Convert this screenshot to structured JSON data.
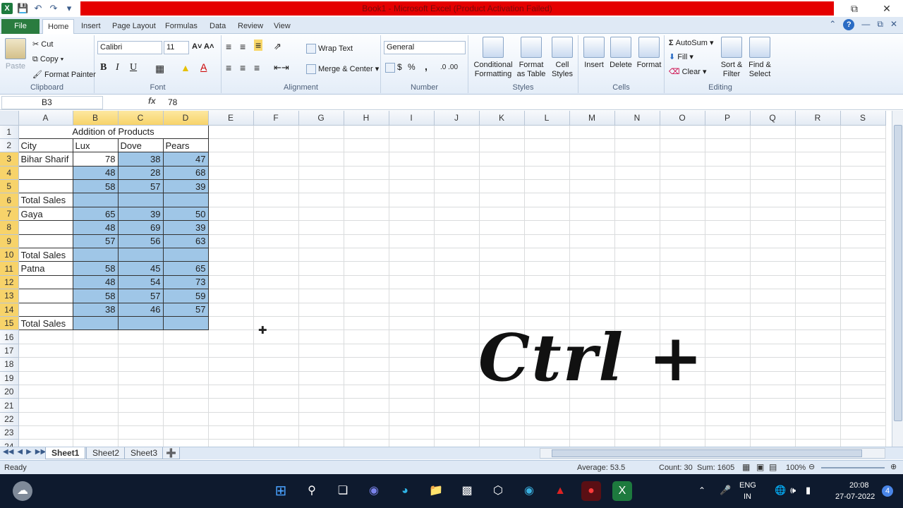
{
  "window": {
    "title": "Book1 - Microsoft Excel (Product Activation Failed)"
  },
  "tabs": [
    "File",
    "Home",
    "Insert",
    "Page Layout",
    "Formulas",
    "Data",
    "Review",
    "View"
  ],
  "ribbon": {
    "clipboard": {
      "paste": "Paste",
      "cut": "Cut",
      "copy": "Copy",
      "format_painter": "Format Painter",
      "label": "Clipboard"
    },
    "font": {
      "name": "Calibri",
      "size": "11",
      "bold": "B",
      "italic": "I",
      "underline": "U",
      "label": "Font"
    },
    "alignment": {
      "wrap_text": "Wrap Text",
      "merge_center": "Merge & Center",
      "label": "Alignment"
    },
    "number": {
      "format": "General",
      "currency": "$",
      "percent": "%",
      "comma": ",",
      "label": "Number"
    },
    "styles": {
      "conditional": "Conditional Formatting",
      "format_table": "Format as Table",
      "cell_styles": "Cell Styles",
      "label": "Styles"
    },
    "cells": {
      "insert": "Insert",
      "delete": "Delete",
      "format": "Format",
      "label": "Cells"
    },
    "editing": {
      "autosum": "AutoSum",
      "fill": "Fill",
      "clear": "Clear",
      "sort_filter": "Sort & Filter",
      "find_select": "Find & Select",
      "label": "Editing"
    }
  },
  "formula_bar": {
    "name_box": "B3",
    "fx": "fx",
    "value": "78"
  },
  "columns": [
    "A",
    "B",
    "C",
    "D",
    "E",
    "F",
    "G",
    "H",
    "I",
    "J",
    "K",
    "L",
    "M",
    "N",
    "O",
    "P",
    "Q",
    "R",
    "S"
  ],
  "sheet": {
    "title": "Addition of Products",
    "headers": [
      "City",
      "Lux",
      "Dove",
      "Pears"
    ],
    "rows": [
      [
        "Bihar Sharif",
        "78",
        "38",
        "47"
      ],
      [
        "",
        "48",
        "28",
        "68"
      ],
      [
        "",
        "58",
        "57",
        "39"
      ],
      [
        "Total Sales",
        "",
        "",
        ""
      ],
      [
        "Gaya",
        "65",
        "39",
        "50"
      ],
      [
        "",
        "48",
        "69",
        "39"
      ],
      [
        "",
        "57",
        "56",
        "63"
      ],
      [
        "Total Sales",
        "",
        "",
        ""
      ],
      [
        "Patna",
        "58",
        "45",
        "65"
      ],
      [
        "",
        "48",
        "54",
        "73"
      ],
      [
        "",
        "58",
        "57",
        "59"
      ],
      [
        "",
        "38",
        "46",
        "57"
      ],
      [
        "Total Sales",
        "",
        "",
        ""
      ]
    ]
  },
  "overlay": {
    "text": "Ctrl +"
  },
  "sheet_tabs": [
    "Sheet1",
    "Sheet2",
    "Sheet3"
  ],
  "status": {
    "ready": "Ready",
    "average": "Average: 53.5",
    "count": "Count: 30",
    "sum": "Sum: 1605",
    "zoom": "100%"
  },
  "tray": {
    "lang1": "ENG",
    "lang2": "IN",
    "time": "20:08",
    "date": "27-07-2022",
    "notifications": "4"
  },
  "colors": {
    "selection_fill": "#9fc6e7",
    "title_bar": "#e50000",
    "excel_green": "#1d7a3e"
  }
}
